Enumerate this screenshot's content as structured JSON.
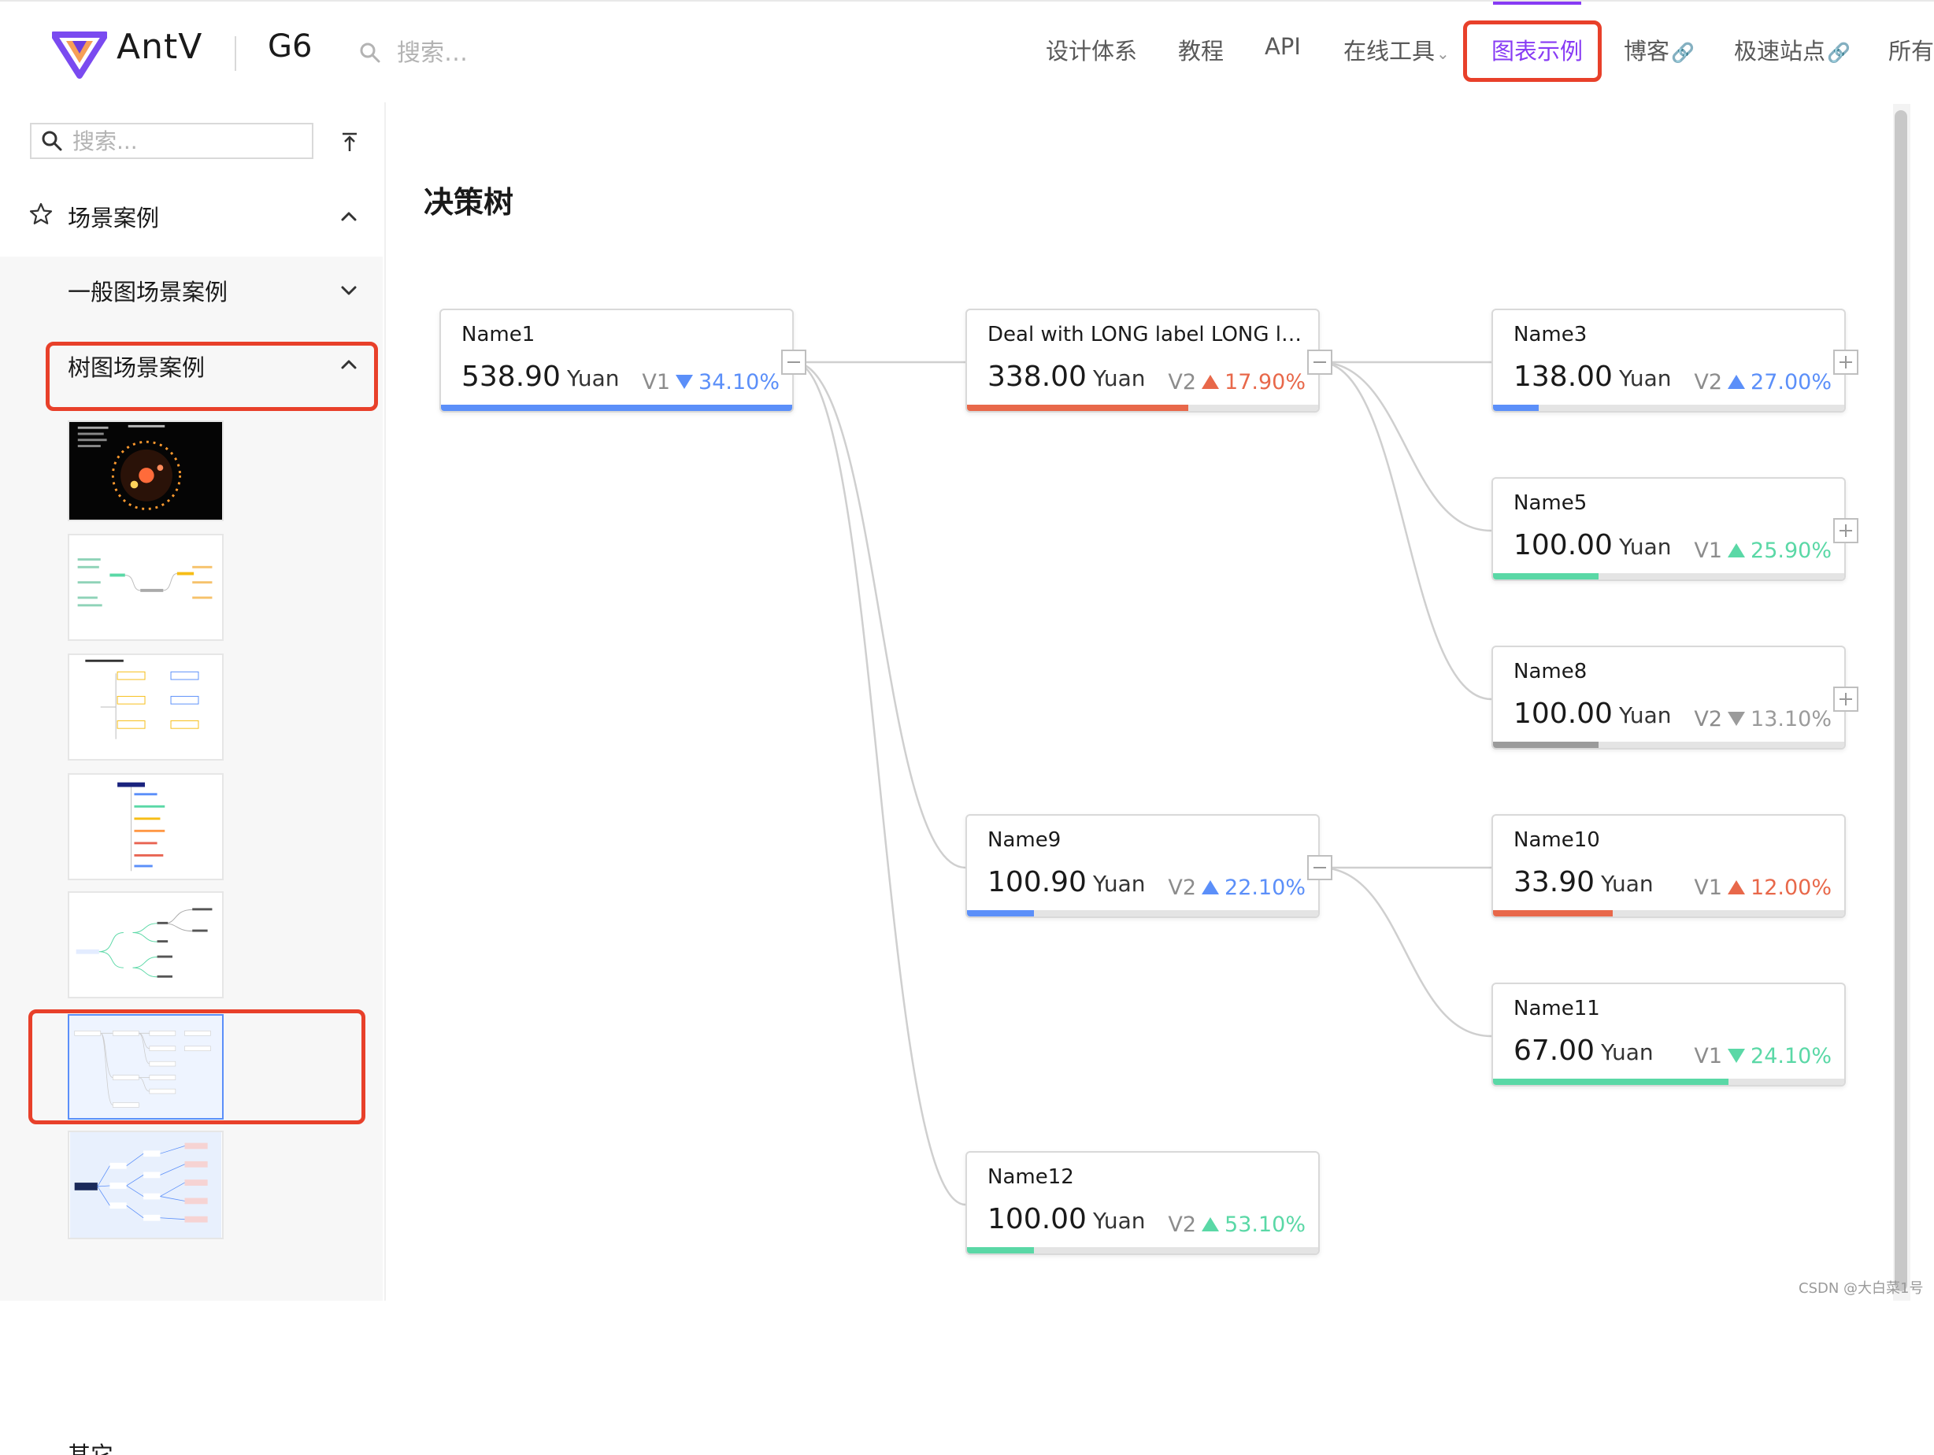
{
  "header": {
    "brand": "AntV",
    "product": "G6",
    "search_placeholder": "搜索…",
    "nav": [
      {
        "label": "设计体系"
      },
      {
        "label": "教程"
      },
      {
        "label": "API"
      },
      {
        "label": "在线工具"
      },
      {
        "label": "图表示例",
        "active": true
      },
      {
        "label": "博客"
      },
      {
        "label": "极速站点"
      },
      {
        "label": "所有"
      }
    ],
    "accent_color": "#873bf4",
    "highlight_color": "#e8402a"
  },
  "sidebar": {
    "search_placeholder": "搜索...",
    "menu_top_label": "场景案例",
    "sub_items": [
      {
        "label": "一般图场景案例",
        "expanded": false
      },
      {
        "label": "树图场景案例",
        "expanded": true
      }
    ],
    "next_item_label": "其它"
  },
  "main": {
    "title": "决策树",
    "nodes": [
      {
        "id": "name1",
        "name": "Name1",
        "amount": "538.90",
        "unit": "Yuan",
        "variable": "V1",
        "trend": "down",
        "rate": "34.10%",
        "color": "#5b8ff9",
        "progress": 1.0,
        "toggle": "collapse"
      },
      {
        "id": "deal",
        "name": "Deal with LONG label LONG la...",
        "amount": "338.00",
        "unit": "Yuan",
        "variable": "V2",
        "trend": "up",
        "rate": "17.90%",
        "color": "#e8684a",
        "progress": 0.63,
        "toggle": "collapse"
      },
      {
        "id": "name3",
        "name": "Name3",
        "amount": "138.00",
        "unit": "Yuan",
        "variable": "V2",
        "trend": "up",
        "rate": "27.00%",
        "color": "#5b8ff9",
        "progress": 0.13,
        "toggle": "expand"
      },
      {
        "id": "name5",
        "name": "Name5",
        "amount": "100.00",
        "unit": "Yuan",
        "variable": "V1",
        "trend": "up",
        "rate": "25.90%",
        "color": "#5ad8a6",
        "progress": 0.3,
        "toggle": "expand"
      },
      {
        "id": "name8",
        "name": "Name8",
        "amount": "100.00",
        "unit": "Yuan",
        "variable": "V2",
        "trend": "down",
        "rate": "13.10%",
        "color": "#9b9b9b",
        "progress": 0.3,
        "toggle": "expand"
      },
      {
        "id": "name9",
        "name": "Name9",
        "amount": "100.90",
        "unit": "Yuan",
        "variable": "V2",
        "trend": "up",
        "rate": "22.10%",
        "color": "#5b8ff9",
        "progress": 0.19,
        "toggle": "collapse"
      },
      {
        "id": "name10",
        "name": "Name10",
        "amount": "33.90",
        "unit": "Yuan",
        "variable": "V1",
        "trend": "up",
        "rate": "12.00%",
        "color": "#e8684a",
        "progress": 0.34,
        "toggle": "none"
      },
      {
        "id": "name11",
        "name": "Name11",
        "amount": "67.00",
        "unit": "Yuan",
        "variable": "V1",
        "trend": "down",
        "rate": "24.10%",
        "color": "#5ad8a6",
        "progress": 0.67,
        "toggle": "none"
      },
      {
        "id": "name12",
        "name": "Name12",
        "amount": "100.00",
        "unit": "Yuan",
        "variable": "V2",
        "trend": "up",
        "rate": "53.10%",
        "color": "#5ad8a6",
        "progress": 0.19,
        "toggle": "none"
      }
    ],
    "edges": [
      [
        "name1",
        "deal"
      ],
      [
        "name1",
        "name9"
      ],
      [
        "name1",
        "name12"
      ],
      [
        "deal",
        "name3"
      ],
      [
        "deal",
        "name5"
      ],
      [
        "deal",
        "name8"
      ],
      [
        "name9",
        "name10"
      ],
      [
        "name9",
        "name11"
      ]
    ]
  },
  "watermark": "CSDN @大白菜1号"
}
